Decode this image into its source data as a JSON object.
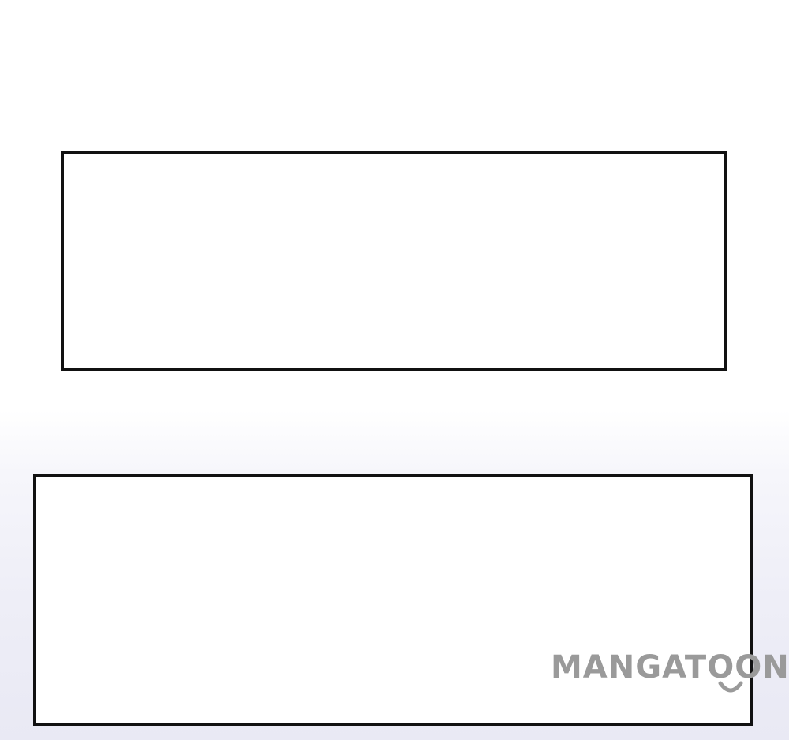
{
  "page": {
    "background_top": "#ffffff",
    "background_bottom": "#e9e9f4"
  },
  "panels": [
    {
      "name": "empty-panel-top",
      "border_color": "#111111",
      "fill": "#ffffff"
    },
    {
      "name": "empty-panel-bottom",
      "border_color": "#111111",
      "fill": "#ffffff"
    }
  ],
  "watermark": {
    "text": "MANGATOON",
    "color": "#9a9a9a"
  }
}
